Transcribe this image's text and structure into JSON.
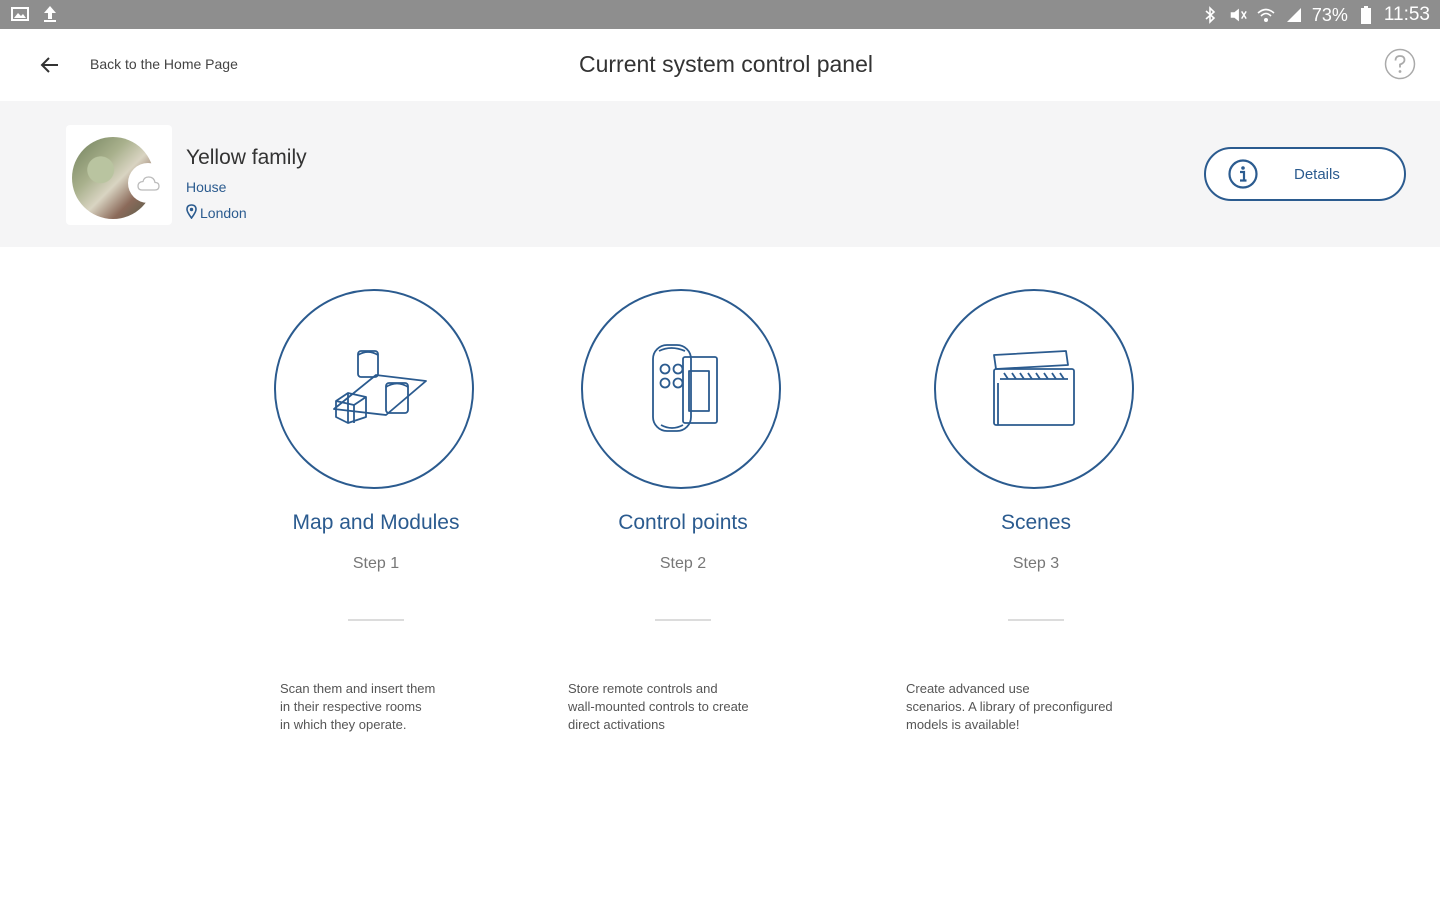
{
  "status_bar": {
    "battery": "73%",
    "time": "11:53"
  },
  "header": {
    "back_label": "Back to the Home Page",
    "title": "Current system control panel"
  },
  "family": {
    "name": "Yellow family",
    "type": "House",
    "location": "London",
    "details_label": "Details"
  },
  "steps": [
    {
      "title": "Map and Modules",
      "step": "Step 1",
      "description": "Scan them and insert them\n in their respective rooms\n in which they operate."
    },
    {
      "title": "Control points",
      "step": "Step 2",
      "description": "Store remote controls and\nwall-mounted controls to create\ndirect activations"
    },
    {
      "title": "Scenes",
      "step": "Step 3",
      "description": "Create advanced use\nscenarios. A library of preconfigured\nmodels is available!"
    }
  ],
  "colors": {
    "accent": "#2b5b8f",
    "status_bar": "#8e8e8e",
    "band": "#f5f5f6"
  }
}
